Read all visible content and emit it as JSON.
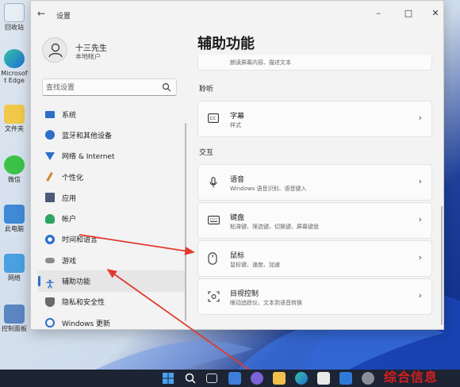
{
  "desktop": {
    "icons": [
      {
        "label": "回收站",
        "icon": "recycle-bin-icon"
      },
      {
        "label": "Microsoft Edge",
        "icon": "edge-icon"
      },
      {
        "label": "文件夹",
        "icon": "folder-icon"
      },
      {
        "label": "微信",
        "icon": "wechat-icon"
      },
      {
        "label": "此电脑",
        "icon": "computer-icon"
      },
      {
        "label": "网络",
        "icon": "network-icon"
      },
      {
        "label": "控制面板",
        "icon": "control-panel-icon"
      }
    ]
  },
  "window": {
    "title": "设置",
    "back_glyph": "←",
    "controls": {
      "minimize": "–",
      "maximize": "□",
      "close": "✕"
    }
  },
  "profile": {
    "name": "十三先生",
    "account_type": "本地帐户"
  },
  "search": {
    "placeholder": "查找设置"
  },
  "nav": {
    "items": [
      {
        "label": "系统",
        "icon": "system-icon",
        "color": "#2b6fc9"
      },
      {
        "label": "蓝牙和其他设备",
        "icon": "bluetooth-icon",
        "color": "#2b6fc9"
      },
      {
        "label": "网络 & Internet",
        "icon": "network-icon",
        "color": "#2b6fc9"
      },
      {
        "label": "个性化",
        "icon": "personalization-icon",
        "color": "#c98a2b"
      },
      {
        "label": "应用",
        "icon": "apps-icon",
        "color": "#4a5a78"
      },
      {
        "label": "帐户",
        "icon": "account-icon",
        "color": "#2fa360"
      },
      {
        "label": "时间和语言",
        "icon": "time-language-icon",
        "color": "#2b6fc9"
      },
      {
        "label": "游戏",
        "icon": "gaming-icon",
        "color": "#7a7a7a"
      },
      {
        "label": "辅助功能",
        "icon": "accessibility-icon",
        "color": "#2b6fc9"
      },
      {
        "label": "隐私和安全性",
        "icon": "privacy-icon",
        "color": "#6a6a6a"
      },
      {
        "label": "Windows 更新",
        "icon": "windows-update-icon",
        "color": "#2b6fc9"
      }
    ],
    "active_index": 8
  },
  "main": {
    "title": "辅助功能",
    "partial_card": {
      "desc": "朗读屏幕内容、描述文本"
    },
    "sections": [
      {
        "header": "聆听",
        "cards": [
          {
            "title": "字幕",
            "desc": "样式",
            "icon": "captions-icon"
          }
        ]
      },
      {
        "header": "交互",
        "cards": [
          {
            "title": "语音",
            "desc": "Windows 语音识别、语音键入",
            "icon": "microphone-icon"
          },
          {
            "title": "键盘",
            "desc": "粘滞键、筛选键、切换键、屏幕键盘",
            "icon": "keyboard-icon"
          },
          {
            "title": "鼠标",
            "desc": "鼠标键、速度、加速",
            "icon": "mouse-icon"
          },
          {
            "title": "目视控制",
            "desc": "眼动追踪仪、文本到语音转换",
            "icon": "eye-control-icon"
          }
        ]
      }
    ],
    "chevron": "›"
  },
  "taskbar": {
    "icons": [
      "start-icon",
      "search-icon",
      "task-view-icon",
      "widgets-icon",
      "chat-icon",
      "file-explorer-icon",
      "edge-icon",
      "store-icon",
      "mail-icon",
      "settings-icon"
    ]
  },
  "watermark": "综合信息",
  "colors": {
    "accent": "#2b6fc9",
    "annotation_arrow": "#e23a2e",
    "watermark": "#d71f1f"
  }
}
